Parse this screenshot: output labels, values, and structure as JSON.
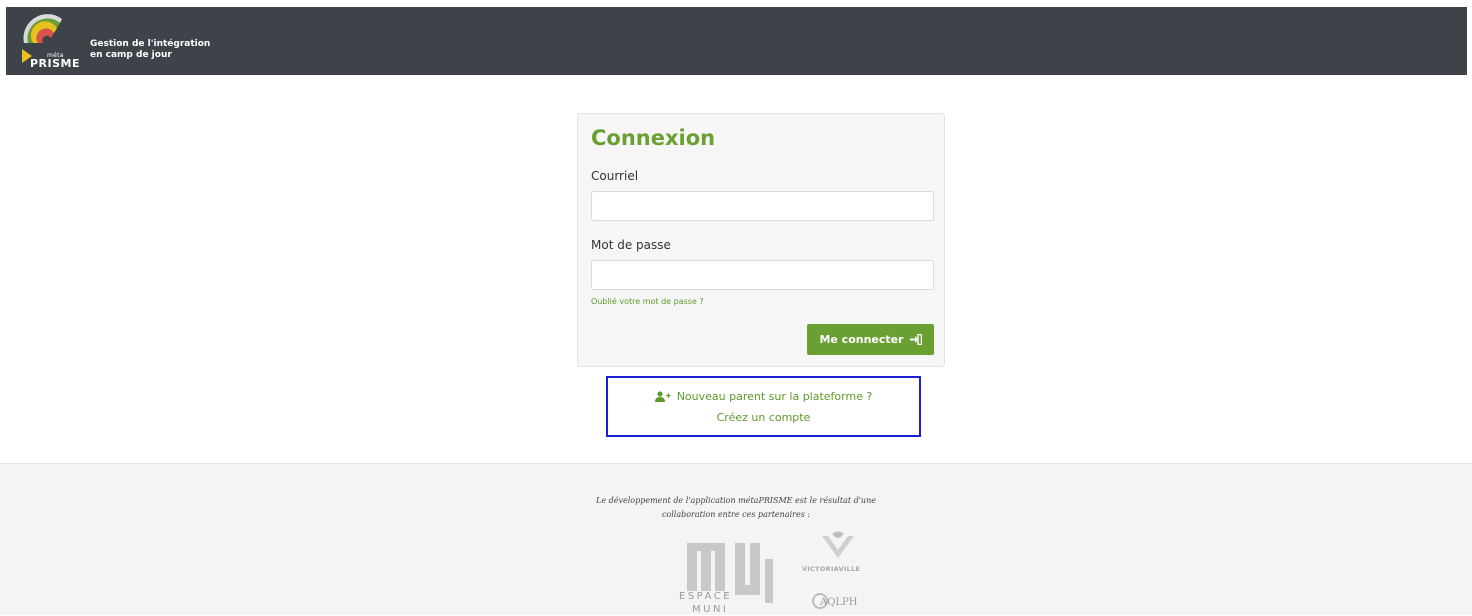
{
  "header": {
    "logo_meta": "méta",
    "logo_word": "PRISME",
    "title_line1": "Gestion de l'intégration",
    "title_line2": "en camp de jour"
  },
  "login": {
    "title": "Connexion",
    "email_label": "Courriel",
    "email_value": "",
    "email_placeholder": "",
    "password_label": "Mot de passe",
    "password_value": "",
    "password_placeholder": "",
    "forgot_link": "Oublié votre mot de passe ?",
    "submit_label": "Me connecter",
    "submit_icon": "sign-in-icon"
  },
  "register": {
    "icon": "user-plus-icon",
    "question": "Nouveau parent sur la plateforme ?",
    "link": "Créez un compte"
  },
  "footer": {
    "text_line1": "Le développement de l'application métaPRISME est le résultat d'une",
    "text_line2": "collaboration entre ces partenaires :",
    "partners": {
      "espace_muni_line1": "ESPACE",
      "espace_muni_line2": "MUNI",
      "victoriaville": "VICTORIAVILLE",
      "aqlph": "AQLPH"
    }
  },
  "colors": {
    "topbar": "#3e434a",
    "accent_green": "#6aa032",
    "link_green": "#5e9a2a",
    "highlight_border": "#1a1fd1",
    "footer_bg": "#f4f4f4"
  }
}
